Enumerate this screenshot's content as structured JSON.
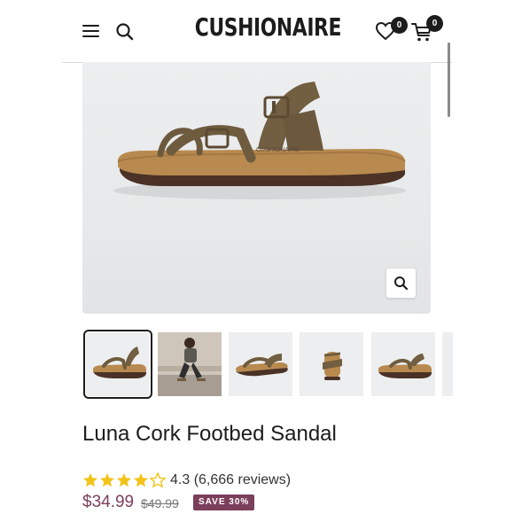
{
  "header": {
    "logo": "CUSHIONAIRE",
    "wishlist_count": "0",
    "cart_count": "0"
  },
  "product": {
    "title": "Luna Cork Footbed Sandal",
    "rating_value": 4.3,
    "rating_text": "4.3 (6,666 reviews)",
    "price": "$34.99",
    "compare_price": "$49.99",
    "save_label": "SAVE 30%"
  },
  "icons": [
    "menu-icon",
    "search-icon",
    "heart-icon",
    "cart-icon",
    "zoom-icon",
    "star-icon"
  ],
  "colors": {
    "text": "#1c1c1c",
    "accent": "#7b3f5c",
    "star": "#f2c318",
    "image_bg": "#eceeef"
  }
}
